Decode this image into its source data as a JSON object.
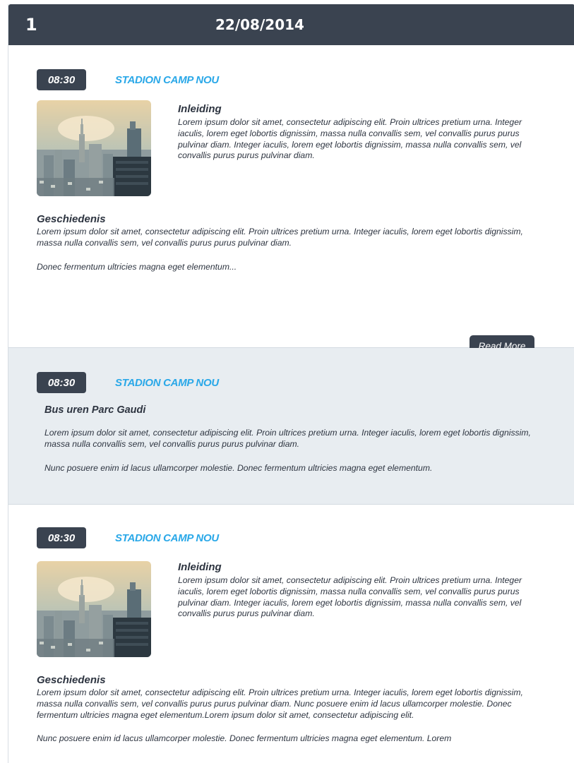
{
  "header": {
    "day_number": "1",
    "date": "22/08/2014"
  },
  "events": [
    {
      "time": "08:30",
      "location": "STADION CAMP NOU",
      "intro_title": "Inleiding",
      "intro_text": "Lorem ipsum dolor sit amet, consectetur adipiscing elit. Proin ultrices pretium urna. Integer iaculis, lorem eget lobortis dignissim, massa nulla convallis sem, vel convallis purus purus pulvinar diam. Integer iaculis, lorem eget lobortis dignissim, massa nulla convallis sem, vel convallis purus purus pulvinar diam.",
      "history_title": "Geschiedenis",
      "history_text": "Lorem ipsum dolor sit amet, consectetur adipiscing elit. Proin ultrices pretium urna. Integer iaculis, lorem eget lobortis dignissim, massa nulla convallis sem, vel convallis purus purus pulvinar diam.",
      "history_text2": "Donec fermentum ultricies magna eget elementum...",
      "read_more": "Read More"
    },
    {
      "time": "08:30",
      "location": "STADION CAMP NOU",
      "title": "Bus uren Parc Gaudi",
      "text1": "Lorem ipsum dolor sit amet, consectetur adipiscing elit. Proin ultrices pretium urna. Integer iaculis, lorem eget lobortis dignissim, massa nulla convallis sem, vel convallis purus purus pulvinar diam.",
      "text2": "Nunc posuere enim id lacus ullamcorper molestie. Donec fermentum ultricies magna eget elementum."
    },
    {
      "time": "08:30",
      "location": "STADION CAMP NOU",
      "intro_title": "Inleiding",
      "intro_text": "Lorem ipsum dolor sit amet, consectetur adipiscing elit. Proin ultrices pretium urna. Integer iaculis, lorem eget lobortis dignissim, massa nulla convallis sem, vel convallis purus purus pulvinar diam. Integer iaculis, lorem eget lobortis dignissim, massa nulla convallis sem, vel convallis purus purus pulvinar diam.",
      "history_title": "Geschiedenis",
      "history_text": "Lorem ipsum dolor sit amet, consectetur adipiscing elit. Proin ultrices pretium urna. Integer iaculis, lorem eget lobortis dignissim, massa nulla convallis sem, vel convallis purus purus pulvinar diam. Nunc posuere enim id lacus ullamcorper molestie. Donec fermentum ultricies magna eget elementum.Lorem ipsum dolor sit amet, consectetur adipiscing elit.",
      "history_text2": "Nunc posuere enim id lacus ullamcorper molestie. Donec fermentum ultricies magna eget elementum. Lorem"
    }
  ],
  "colors": {
    "dark": "#3a4350",
    "accent": "#2aa8e8",
    "alt_bg": "#e8edf1"
  },
  "icons": {
    "photo": "city-skyline-photo"
  }
}
